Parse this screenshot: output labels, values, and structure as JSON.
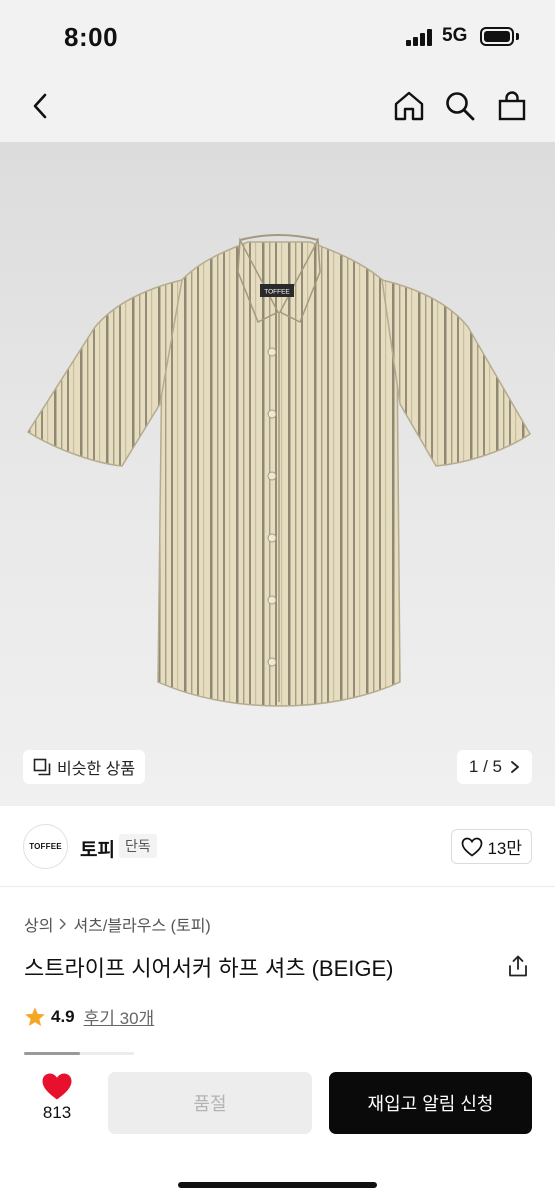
{
  "status_bar": {
    "time": "8:00",
    "network": "5G"
  },
  "nav": {
    "back_icon": "chevron-left-icon",
    "home_icon": "home-icon",
    "search_icon": "search-icon",
    "cart_icon": "shopping-bag-icon"
  },
  "gallery": {
    "similar_label": "비슷한 상품",
    "page_indicator": "1 / 5",
    "image_label": "TOFFEE"
  },
  "brand": {
    "logo_text": "TOFFEE",
    "name": "토피",
    "tag": "단독",
    "likes": "13만"
  },
  "product": {
    "breadcrumb": [
      "상의",
      "셔츠/블라우스 (토피)"
    ],
    "title": "스트라이프 시어서커 하프 셔츠 (BEIGE)",
    "rating": "4.9",
    "reviews": "후기 30개"
  },
  "bottom_bar": {
    "wish_count": "813",
    "soldout_label": "품절",
    "restock_label": "재입고 알림 신청"
  },
  "colors": {
    "accent": "#e8112d",
    "star": "#f5a623",
    "primary_button": "#0a0a0a",
    "disabled_button": "#ededed"
  }
}
